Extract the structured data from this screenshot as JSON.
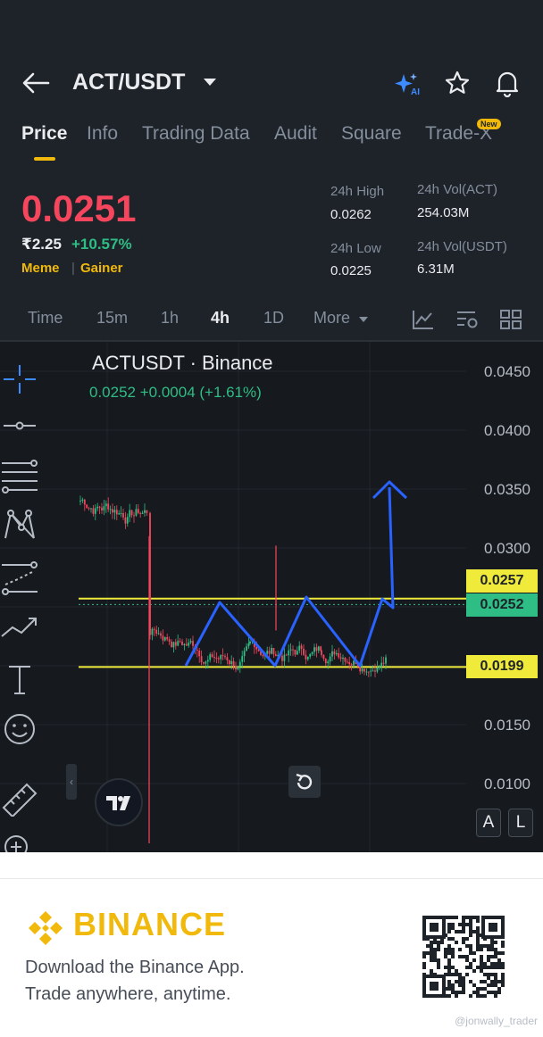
{
  "header": {
    "pair": "ACT/USDT",
    "icons": [
      "back-arrow-icon",
      "ai-sparkle-icon",
      "star-icon",
      "bell-icon"
    ]
  },
  "tabs": [
    {
      "label": "Price",
      "active": true
    },
    {
      "label": "Info"
    },
    {
      "label": "Trading Data"
    },
    {
      "label": "Audit"
    },
    {
      "label": "Square"
    },
    {
      "label": "Trade-X",
      "badge": "New"
    }
  ],
  "ticker": {
    "last_price": "0.0251",
    "inr_price": "₹2.25",
    "change_pct": "+10.57%",
    "tags": [
      "Meme",
      "Gainer"
    ],
    "stats": {
      "high_label": "24h High",
      "high_value": "0.0262",
      "low_label": "24h Low",
      "low_value": "0.0225",
      "vol_act_label": "24h Vol(ACT)",
      "vol_act_value": "254.03M",
      "vol_usdt_label": "24h Vol(USDT)",
      "vol_usdt_value": "6.31M"
    }
  },
  "timeframes": [
    {
      "label": "Time"
    },
    {
      "label": "15m"
    },
    {
      "label": "1h"
    },
    {
      "label": "4h",
      "active": true
    },
    {
      "label": "1D"
    },
    {
      "label": "More"
    }
  ],
  "chart": {
    "symbol": "ACTUSDT · Binance",
    "ohlc_line": "0.0252  +0.0004 (+1.61%)",
    "price_axis": [
      "0.0450",
      "0.0400",
      "0.0350",
      "0.0300",
      "0.0150",
      "0.0100"
    ],
    "horizontal_levels": [
      {
        "label": "0.0257",
        "value": 0.0257,
        "color": "#f0ea3a"
      },
      {
        "label": "0.0252",
        "value": 0.0252,
        "color": "#2ebd85"
      },
      {
        "label": "0.0199",
        "value": 0.0199,
        "color": "#f0ea3a"
      }
    ],
    "drawing_tools": [
      "crosshair-icon",
      "horizontal-line-icon",
      "fib-lines-icon",
      "pattern-icon",
      "projection-icon",
      "trend-icon",
      "text-tool-icon",
      "emoji-icon",
      "ruler-icon",
      "zoom-in-icon"
    ],
    "scale_buttons": [
      "A",
      "L"
    ],
    "colors": {
      "up": "#2ebd85",
      "down": "#f6465d",
      "drawing": "#2962ff",
      "level": "#f0ea3a"
    }
  },
  "footer": {
    "brand": "BINANCE",
    "line1": "Download the Binance App.",
    "line2": "Trade anywhere, anytime.",
    "watermark": "@jonwally_trader"
  }
}
